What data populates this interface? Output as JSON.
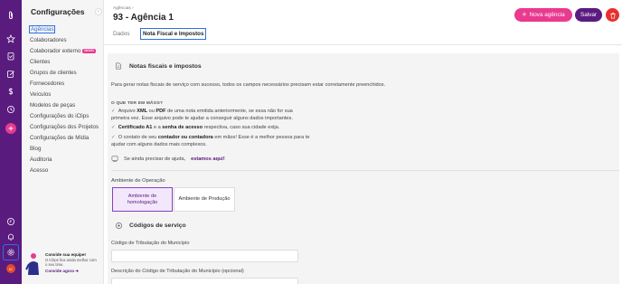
{
  "sidebar": {
    "title": "Configurações",
    "items": [
      {
        "label": "Agências",
        "active": true
      },
      {
        "label": "Colaboradores"
      },
      {
        "label": "Colaborador externo",
        "badge": "NOVO"
      },
      {
        "label": "Clientes"
      },
      {
        "label": "Grupos de clientes"
      },
      {
        "label": "Fornecedores"
      },
      {
        "label": "Veículos"
      },
      {
        "label": "Modelos de peças"
      },
      {
        "label": "Configurações do iClips"
      },
      {
        "label": "Configurações dos Projetos"
      },
      {
        "label": "Configurações de Mídia"
      },
      {
        "label": "Blog"
      },
      {
        "label": "Auditoria"
      },
      {
        "label": "Acesso"
      }
    ],
    "invite": {
      "title": "Convide sua equipe!",
      "text": "O iClips fica ainda melhor com o seu time.",
      "link": "Convide agora"
    }
  },
  "rail": {
    "avatar_initials": "IC"
  },
  "header": {
    "breadcrumb": "Agências",
    "title": "93 - Agência 1",
    "tabs": [
      "Dados",
      "Nota Fiscal e Impostos"
    ],
    "new_button": "Nova agência",
    "save_button": "Salvar"
  },
  "content": {
    "section_title": "Notas fiscais e impostos",
    "intro": "Para gerar notas fiscais de serviço com sucesso, todos os campos necessários precisam estar corretamente preenchidos.",
    "why_title": "O QUE TER EM MÃOS?",
    "checklist": [
      {
        "pre": "Arquivo ",
        "b1": "XML",
        "mid": " ou ",
        "b2": "PDF",
        "post": " de uma nota emitida anteriormente, se essa não for sua primeira vez. Esse arquivo pode te ajudar a conseguir alguns dados importantes."
      },
      {
        "pre": "",
        "b1": "Certificado A1",
        "mid": " e a ",
        "b2": "senha de acesso",
        "post": " respectiva, caso sua cidade exija."
      },
      {
        "pre": "O contato de seu ",
        "b1": "contador ou contadora",
        "mid": " em mãos! Esse é a melhor pessoa para te ajudar com alguns dados mais complexos.",
        "b2": "",
        "post": ""
      }
    ],
    "help_text": "Se ainda precisar de ajuda,",
    "help_link": "estamos aqui!",
    "environment_label": "Ambiente de Operação",
    "environment_options": [
      "Ambiente de homologação",
      "Ambiente de Produção"
    ],
    "environment_selected": "Ambiente de homologação",
    "codes_title": "Códigos de serviço",
    "field1_label": "Código de Tributação do Município",
    "field1_value": "",
    "field2_label": "Descrição do Código de Tributação do Município (opcional)",
    "field2_value": ""
  },
  "colors": {
    "rail": "#5a1b7f",
    "accent_pink": "#e93a8f",
    "save": "#5a1b7f",
    "delete": "#e8312f",
    "selection_outline": "#2f6fe0"
  }
}
